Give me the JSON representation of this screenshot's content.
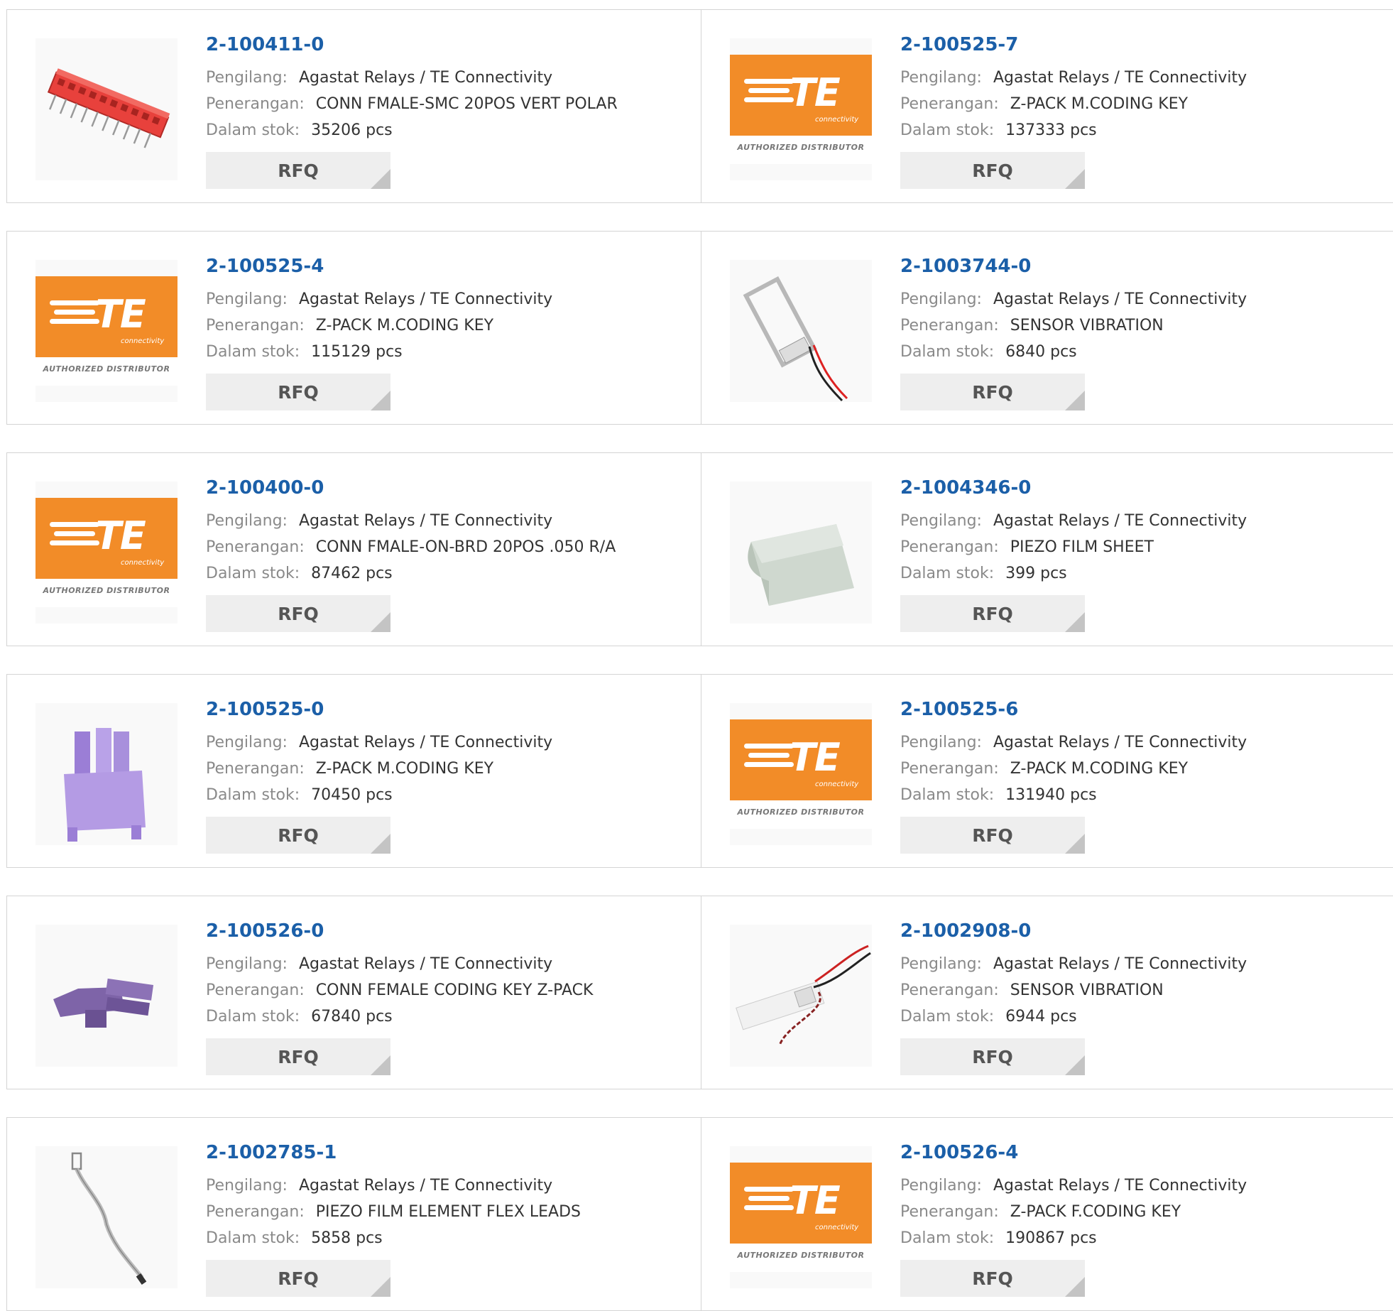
{
  "colors": {
    "part_link": "#1b5fa8",
    "label": "#8a8a8a",
    "te_orange": "#f28c28",
    "rfq_bg": "#eeeeee"
  },
  "labels": {
    "manufacturer": "Pengilang:",
    "description": "Penerangan:",
    "stock": "Dalam stok:"
  },
  "rfq_label": "RFQ",
  "te_logo": {
    "text": "TE",
    "sub": "connectivity",
    "authorized": "AUTHORIZED DISTRIBUTOR"
  },
  "products": [
    {
      "part": "2-100411-0",
      "manufacturer": "Agastat Relays / TE Connectivity",
      "description": "CONN FMALE-SMC 20POS VERT POLAR",
      "stock": "35206 pcs",
      "image": "red-connector"
    },
    {
      "part": "2-100525-7",
      "manufacturer": "Agastat Relays / TE Connectivity",
      "description": "Z-PACK M.CODING KEY",
      "stock": "137333 pcs",
      "image": "te-logo"
    },
    {
      "part": "2-100525-4",
      "manufacturer": "Agastat Relays / TE Connectivity",
      "description": "Z-PACK M.CODING KEY",
      "stock": "115129 pcs",
      "image": "te-logo"
    },
    {
      "part": "2-1003744-0",
      "manufacturer": "Agastat Relays / TE Connectivity",
      "description": "SENSOR VIBRATION",
      "stock": "6840 pcs",
      "image": "vibration-sensor-frame"
    },
    {
      "part": "2-100400-0",
      "manufacturer": "Agastat Relays / TE Connectivity",
      "description": "CONN FMALE-ON-BRD 20POS .050 R/A",
      "stock": "87462 pcs",
      "image": "te-logo"
    },
    {
      "part": "2-1004346-0",
      "manufacturer": "Agastat Relays / TE Connectivity",
      "description": "PIEZO FILM SHEET",
      "stock": "399 pcs",
      "image": "film-sheet"
    },
    {
      "part": "2-100525-0",
      "manufacturer": "Agastat Relays / TE Connectivity",
      "description": "Z-PACK M.CODING KEY",
      "stock": "70450 pcs",
      "image": "purple-key-upright"
    },
    {
      "part": "2-100525-6",
      "manufacturer": "Agastat Relays / TE Connectivity",
      "description": "Z-PACK M.CODING KEY",
      "stock": "131940 pcs",
      "image": "te-logo"
    },
    {
      "part": "2-100526-0",
      "manufacturer": "Agastat Relays / TE Connectivity",
      "description": "CONN FEMALE CODING KEY Z-PACK",
      "stock": "67840 pcs",
      "image": "purple-key-side"
    },
    {
      "part": "2-1002908-0",
      "manufacturer": "Agastat Relays / TE Connectivity",
      "description": "SENSOR VIBRATION",
      "stock": "6944 pcs",
      "image": "vibration-sensor-strip"
    },
    {
      "part": "2-1002785-1",
      "manufacturer": "Agastat Relays / TE Connectivity",
      "description": "PIEZO FILM ELEMENT FLEX LEADS",
      "stock": "5858 pcs",
      "image": "flex-lead"
    },
    {
      "part": "2-100526-4",
      "manufacturer": "Agastat Relays / TE Connectivity",
      "description": "Z-PACK F.CODING KEY",
      "stock": "190867 pcs",
      "image": "te-logo"
    }
  ]
}
